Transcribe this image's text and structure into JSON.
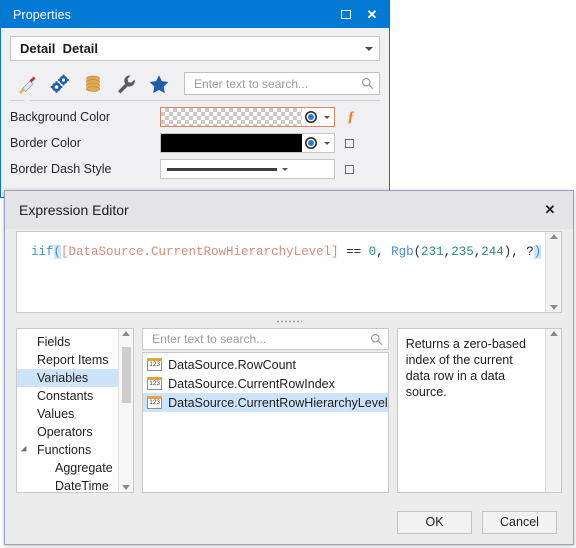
{
  "properties_window": {
    "title": "Properties",
    "window_controls": {
      "maximize": "maximize-icon",
      "close": "close-icon"
    },
    "element_combo": {
      "value": "Detail  Detail"
    },
    "toolbar": {
      "icons": [
        {
          "name": "appearance-paintbrush-icon",
          "selected": true
        },
        {
          "name": "behavior-gears-icon",
          "selected": false
        },
        {
          "name": "data-database-icon",
          "selected": false
        },
        {
          "name": "actions-wrench-icon",
          "selected": false
        },
        {
          "name": "favorites-star-icon",
          "selected": false
        }
      ],
      "search_placeholder": "Enter text to search..."
    },
    "rows": [
      {
        "label": "Background Color",
        "editor": "color",
        "value": "transparent",
        "focused": true,
        "has_expression_button": true
      },
      {
        "label": "Border Color",
        "editor": "color",
        "value": "#000000",
        "focused": false,
        "has_expression_button": false
      },
      {
        "label": "Border Dash Style",
        "editor": "dash",
        "value": "Solid",
        "focused": false,
        "has_expression_button": false
      }
    ]
  },
  "expression_editor": {
    "title": "Expression Editor",
    "close_label": "✕",
    "expression_tokens": [
      {
        "text": "iif",
        "type": "fn"
      },
      {
        "text": "(",
        "type": "match"
      },
      {
        "text": "[DataSource.CurrentRowHierarchyLevel]",
        "type": "field"
      },
      {
        "text": " == ",
        "type": "op"
      },
      {
        "text": "0",
        "type": "num"
      },
      {
        "text": ", ",
        "type": "plain"
      },
      {
        "text": "Rgb",
        "type": "fn"
      },
      {
        "text": "(",
        "type": "plain"
      },
      {
        "text": "231",
        "type": "num"
      },
      {
        "text": ",",
        "type": "plain"
      },
      {
        "text": "235",
        "type": "num"
      },
      {
        "text": ",",
        "type": "plain"
      },
      {
        "text": "244",
        "type": "num"
      },
      {
        "text": "), ?",
        "type": "plain"
      },
      {
        "text": ")",
        "type": "match"
      }
    ],
    "expression_plain": "iif([DataSource.CurrentRowHierarchyLevel] == 0, Rgb(231,235,244), ?)",
    "categories": [
      {
        "label": "Fields",
        "selected": false,
        "child": false,
        "expander": false
      },
      {
        "label": "Report Items",
        "selected": false,
        "child": false,
        "expander": false
      },
      {
        "label": "Variables",
        "selected": true,
        "child": false,
        "expander": false
      },
      {
        "label": "Constants",
        "selected": false,
        "child": false,
        "expander": false
      },
      {
        "label": "Values",
        "selected": false,
        "child": false,
        "expander": false
      },
      {
        "label": "Operators",
        "selected": false,
        "child": false,
        "expander": false
      },
      {
        "label": "Functions",
        "selected": false,
        "child": false,
        "expander": true
      },
      {
        "label": "Aggregate",
        "selected": false,
        "child": true,
        "expander": false
      },
      {
        "label": "DateTime",
        "selected": false,
        "child": true,
        "expander": false
      }
    ],
    "list_search_placeholder": "Enter text to search...",
    "items": [
      {
        "label": "DataSource.RowCount",
        "icon": "number-type-icon",
        "selected": false
      },
      {
        "label": "DataSource.CurrentRowIndex",
        "icon": "number-type-icon",
        "selected": false
      },
      {
        "label": "DataSource.CurrentRowHierarchyLevel",
        "icon": "number-type-icon",
        "selected": true
      }
    ],
    "description": "Returns a zero-based index of the current data row in a data source.",
    "buttons": {
      "ok": "OK",
      "cancel": "Cancel"
    }
  },
  "colors": {
    "title_bar_blue": "#0078d4",
    "selection_blue": "#cde3f7",
    "expression_orange": "#e8820c",
    "token_function": "#3f8fd0",
    "token_field": "#d98a7a",
    "token_number": "#2a8a7a"
  }
}
